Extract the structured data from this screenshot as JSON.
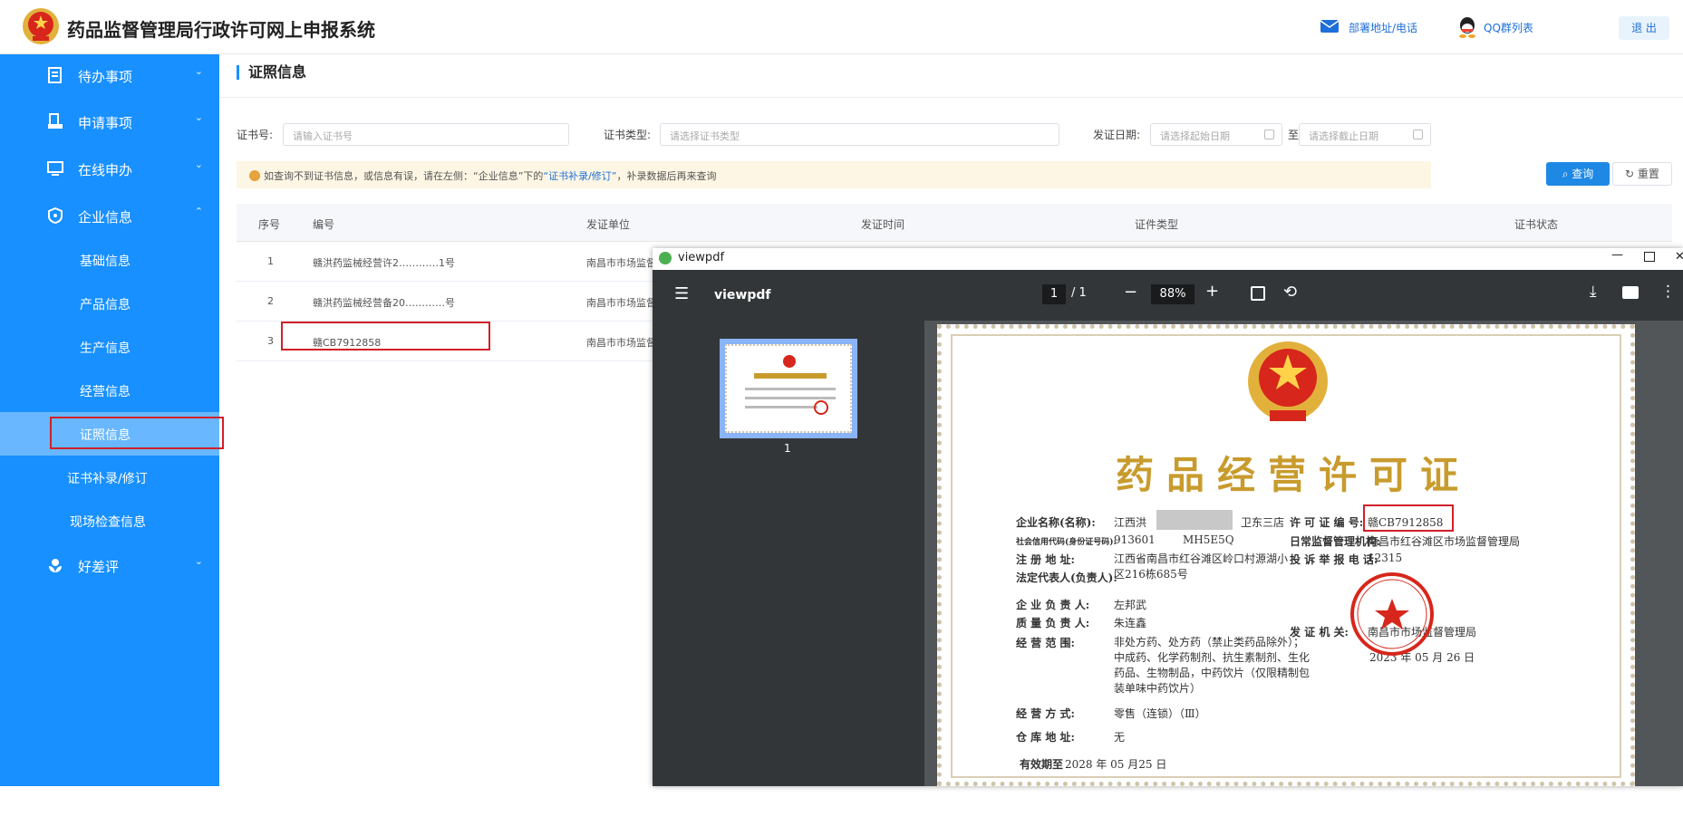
{
  "app": {
    "title": "药品监督管理局行政许可网上申报系统"
  },
  "header": {
    "contact_link": "部署地址/电话",
    "qq_link": "QQ群列表",
    "logout_label": "退 出"
  },
  "sidebar": {
    "items": [
      {
        "label": "待办事项",
        "icon": "inbox-icon"
      },
      {
        "label": "申请事项",
        "icon": "apply-icon"
      },
      {
        "label": "在线申办",
        "icon": "monitor-icon"
      },
      {
        "label": "企业信息",
        "icon": "enterprise-icon"
      }
    ],
    "sub_items": [
      "基础信息",
      "产品信息",
      "生产信息",
      "经营信息",
      "证照信息",
      "证书补录/修订",
      "现场检查信息"
    ],
    "review": {
      "label": "好差评",
      "icon": "flower-icon"
    }
  },
  "main": {
    "title": "证照信息",
    "filters": {
      "cert_no_label": "证书号:",
      "cert_no_placeholder": "请输入证书号",
      "cert_type_label": "证书类型:",
      "cert_type_placeholder": "请选择证书类型",
      "date_label": "发证日期:",
      "date_start_placeholder": "请选择起始日期",
      "date_sep": "至",
      "date_end_placeholder": "请选择截止日期"
    },
    "notice": {
      "pre": "如查询不到证书信息，或信息有误，请在左侧：“企业信息”下的",
      "link": "“证书补录/修订”",
      "post": "，补录数据后再来查询"
    },
    "buttons": {
      "query": "查询",
      "reset": "重置"
    },
    "table": {
      "headers": [
        "序号",
        "编号",
        "发证单位",
        "发证时间",
        "证件类型",
        "证书状态"
      ],
      "rows": [
        {
          "no": "1",
          "code": "赣洪药监械经营许2…………1号",
          "issuer": "南昌市市场监督"
        },
        {
          "no": "2",
          "code": "赣洪药监械经营备20…………号",
          "issuer": "南昌市市场监督"
        },
        {
          "no": "3",
          "code": "赣CB7912858",
          "issuer": "南昌市市场监督"
        }
      ]
    }
  },
  "pdf": {
    "window_title": "viewpdf",
    "toolbar_title": "viewpdf",
    "page_current": "1",
    "page_total": "/ 1",
    "zoom": "88%",
    "thumb_label": "1",
    "cert": {
      "title": "药品经营许可证",
      "enterprise_name_label": "企业名称(名称):",
      "enterprise_name_value": "江西洪",
      "enterprise_name_tail": "卫东三店",
      "credit_code_label": "社会信用代码(身份证号码):",
      "credit_code_value": "913601",
      "credit_code_tail": "MH5E5Q",
      "address_label": "注 册 地 址:",
      "address_value": "江西省南昌市红谷滩区岭口村源湖小区216栋685号",
      "legal_label": "法定代表人(负责人):",
      "principal_label": "企 业 负 责 人:",
      "principal_value": "左邦武",
      "quality_label": "质 量 负 责 人:",
      "quality_value": "朱连鑫",
      "scope_label": "经 营 范 围:",
      "scope_value": "非处方药、处方药（禁止类药品除外）；中成药、化学药制剂、抗生素制剂、生化药品、生物制品，中药饮片（仅限精制包装单味中药饮片）",
      "license_no_label": "许 可 证 编 号:",
      "license_no_value": "赣CB7912858",
      "supervisor_label": "日常监督管理机构:",
      "supervisor_value": "南昌市红谷滩区市场监督管理局",
      "complaint_label": "投 诉 举 报 电 话:",
      "complaint_value": "12315",
      "issuer_label": "发 证 机 关:",
      "issuer_value": "南昌市市场监督管理局",
      "issue_date": "2023 年 05 月 26 日",
      "mode_label": "经 营 方 式:",
      "mode_value": "零售（连锁）（Ⅲ）",
      "warehouse_label": "仓 库 地 址:",
      "warehouse_value": "无",
      "valid_label": "有效期至",
      "valid_value": "2028 年 05 月25 日"
    }
  },
  "colors": {
    "sidebar": "#1890ff",
    "active": "#69b8ff",
    "pdf_dark": "#323639",
    "highlight": "#d0202a",
    "cert_gold": "#c89b2d"
  }
}
